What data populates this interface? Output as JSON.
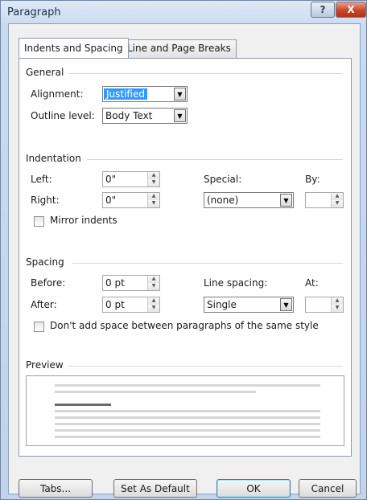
{
  "window": {
    "title": "Paragraph",
    "help_label": "?",
    "close_label": "X"
  },
  "tabs": [
    {
      "label": "Indents and Spacing"
    },
    {
      "label": "Line and Page Breaks"
    }
  ],
  "general": {
    "title": "General",
    "alignment_label": "Alignment:",
    "alignment_value": "Justified",
    "outline_label": "Outline level:",
    "outline_value": "Body Text"
  },
  "indentation": {
    "title": "Indentation",
    "left_label": "Left:",
    "left_value": "0\"",
    "right_label": "Right:",
    "right_value": "0\"",
    "special_label": "Special:",
    "special_value": "(none)",
    "by_label": "By:",
    "by_value": "",
    "mirror_label": "Mirror indents"
  },
  "spacing": {
    "title": "Spacing",
    "before_label": "Before:",
    "before_value": "0 pt",
    "after_label": "After:",
    "after_value": "0 pt",
    "line_spacing_label": "Line spacing:",
    "line_spacing_value": "Single",
    "at_label": "At:",
    "at_value": "",
    "dont_add_label": "Don't add space between paragraphs of the same style"
  },
  "preview": {
    "title": "Preview"
  },
  "buttons": {
    "tabs": "Tabs...",
    "default": "Set As Default",
    "ok": "OK",
    "cancel": "Cancel"
  }
}
